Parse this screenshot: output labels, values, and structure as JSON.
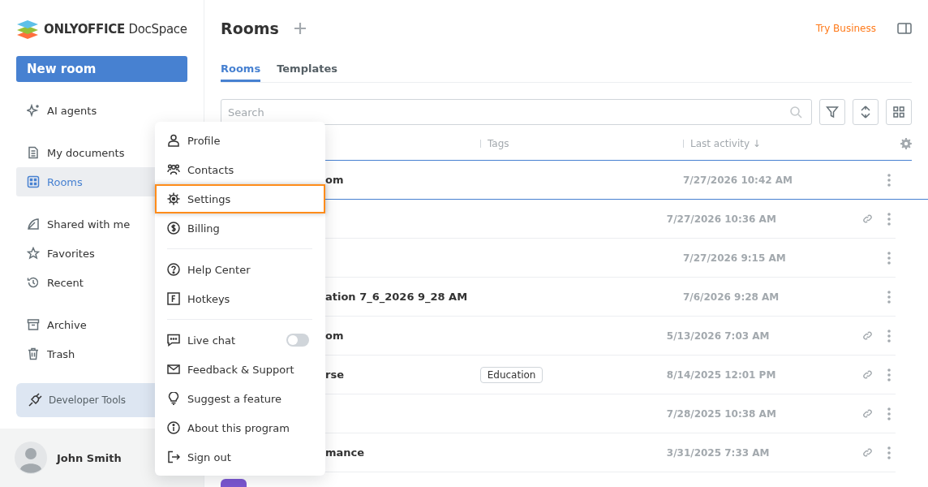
{
  "logo": {
    "brand": "ONLYOFFICE",
    "product": "DocSpace"
  },
  "new_room_button": "New room",
  "sidebar": {
    "groups": [
      [
        {
          "label": "AI agents",
          "selected": false
        }
      ],
      [
        {
          "label": "My documents",
          "selected": false
        },
        {
          "label": "Rooms",
          "selected": true
        }
      ],
      [
        {
          "label": "Shared with me",
          "selected": false
        },
        {
          "label": "Favorites",
          "selected": false
        },
        {
          "label": "Recent",
          "selected": false
        }
      ],
      [
        {
          "label": "Archive",
          "selected": false
        },
        {
          "label": "Trash",
          "selected": false
        }
      ]
    ]
  },
  "developer_tools": "Developer Tools",
  "user": {
    "name": "John Smith"
  },
  "header": {
    "title": "Rooms",
    "try_business": "Try Business"
  },
  "tabs": [
    {
      "label": "Rooms",
      "selected": true
    },
    {
      "label": "Templates",
      "selected": false
    }
  ],
  "search": {
    "placeholder": "Search"
  },
  "table": {
    "columns": [
      "Tags",
      "Last activity ↓"
    ],
    "rows": [
      {
        "name": "om",
        "tag": "",
        "activity": "7/27/2026 10:42 AM",
        "shared": false,
        "selected": true
      },
      {
        "name": "",
        "tag": "",
        "activity": "7/27/2026 10:36 AM",
        "shared": true,
        "selected": false
      },
      {
        "name": "",
        "tag": "",
        "activity": "7/27/2026 9:15 AM",
        "shared": false,
        "selected": false
      },
      {
        "name": "ation 7_6_2026 9_28 AM",
        "tag": "",
        "activity": "7/6/2026 9:28 AM",
        "shared": false,
        "selected": false
      },
      {
        "name": "om",
        "tag": "",
        "activity": "5/13/2026 7:03 AM",
        "shared": true,
        "selected": false
      },
      {
        "name": "rse",
        "tag": "Education",
        "activity": "8/14/2025 12:01 PM",
        "shared": true,
        "selected": false
      },
      {
        "name": "",
        "tag": "",
        "activity": "7/28/2025 10:38 AM",
        "shared": true,
        "selected": false
      },
      {
        "name": "mance",
        "tag": "",
        "activity": "3/31/2025 7:33 AM",
        "shared": true,
        "selected": false
      },
      {
        "name": "",
        "tag": "",
        "activity": "",
        "shared": false,
        "selected": false,
        "color": "#7b57d1"
      }
    ]
  },
  "menu": [
    {
      "kind": "item",
      "label": "Profile",
      "selected": false
    },
    {
      "kind": "item",
      "label": "Contacts",
      "selected": false
    },
    {
      "kind": "item",
      "label": "Settings",
      "selected": true
    },
    {
      "kind": "item",
      "label": "Billing",
      "selected": false
    },
    {
      "kind": "separator"
    },
    {
      "kind": "item",
      "label": "Help Center",
      "selected": false
    },
    {
      "kind": "item",
      "label": "Hotkeys",
      "selected": false
    },
    {
      "kind": "separator"
    },
    {
      "kind": "toggle",
      "label": "Live chat",
      "on": false
    },
    {
      "kind": "item",
      "label": "Feedback & Support",
      "selected": false
    },
    {
      "kind": "item",
      "label": "Suggest a feature",
      "selected": false
    },
    {
      "kind": "item",
      "label": "About this program",
      "selected": false
    },
    {
      "kind": "item",
      "label": "Sign out",
      "selected": false
    }
  ]
}
